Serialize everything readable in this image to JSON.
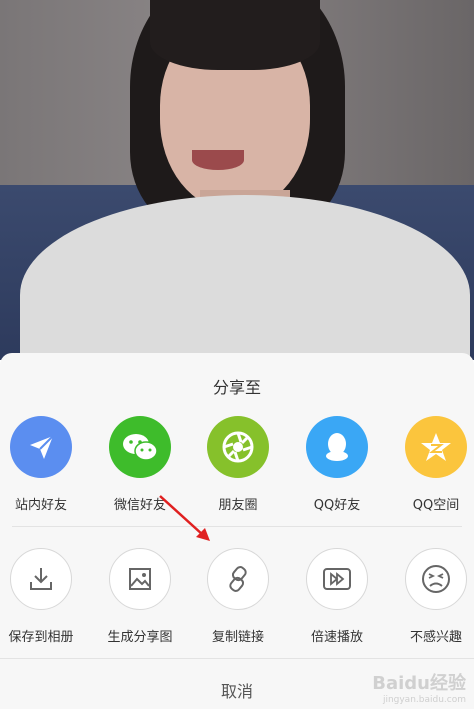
{
  "share_sheet": {
    "title": "分享至",
    "row1": [
      {
        "label": "站内好友",
        "icon": "send-icon",
        "color": "#5b8ef0"
      },
      {
        "label": "微信好友",
        "icon": "wechat-icon",
        "color": "#3ebc2b"
      },
      {
        "label": "朋友圈",
        "icon": "moments-icon",
        "color": "#86c12b"
      },
      {
        "label": "QQ好友",
        "icon": "qq-icon",
        "color": "#3aa7f5"
      },
      {
        "label": "QQ空间",
        "icon": "qzone-icon",
        "color": "#fbc53d"
      }
    ],
    "row2": [
      {
        "label": "保存到相册",
        "icon": "download-icon"
      },
      {
        "label": "生成分享图",
        "icon": "image-icon"
      },
      {
        "label": "复制链接",
        "icon": "link-icon"
      },
      {
        "label": "倍速播放",
        "icon": "speed-icon"
      },
      {
        "label": "不感兴趣",
        "icon": "dislike-face-icon"
      }
    ],
    "cancel": "取消"
  },
  "watermark": {
    "brand": "Baidu经验",
    "url": "jingyan.baidu.com"
  },
  "annotation_color": "#e02020"
}
